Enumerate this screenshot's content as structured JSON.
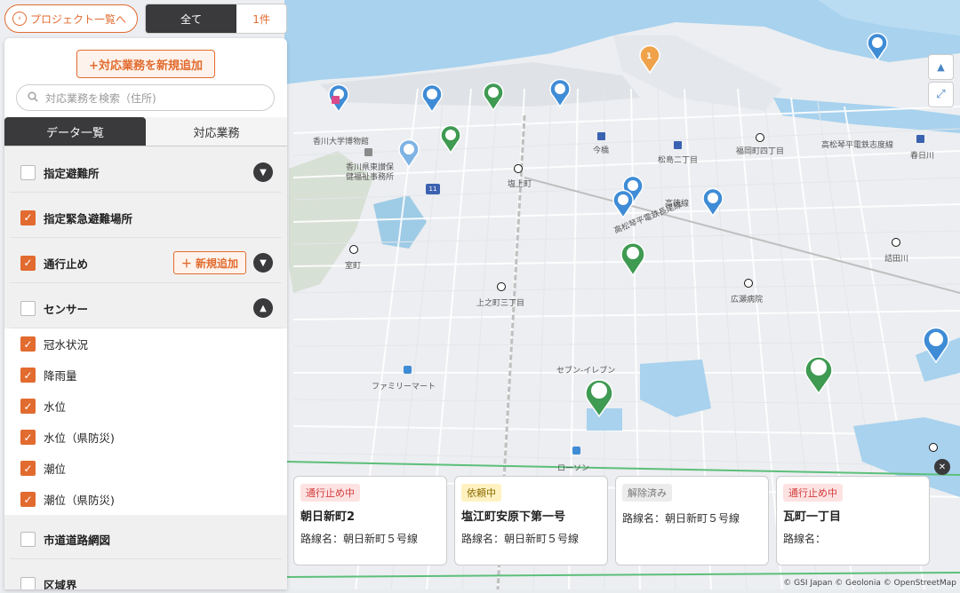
{
  "topbar": {
    "back_label": "プロジェクト一覧へ",
    "filter_all": "全て",
    "filter_count": "1件"
  },
  "panel": {
    "add_button": "+対応業務を新規追加",
    "search_placeholder": "対応業務を検索（住所)",
    "tabs": [
      "データ一覧",
      "対応業務"
    ],
    "rows": [
      {
        "label": "指定避難所",
        "checked": false,
        "chevron": "down"
      },
      {
        "label": "指定緊急避難場所",
        "checked": true
      },
      {
        "label": "通行止め",
        "checked": true,
        "chevron": "down",
        "add_label": "＋ 新規追加"
      },
      {
        "label": "センサー",
        "checked": false,
        "chevron": "up"
      },
      {
        "label": "冠水状況",
        "checked": true
      },
      {
        "label": "降雨量",
        "checked": true
      },
      {
        "label": "水位",
        "checked": true
      },
      {
        "label": "水位（県防災)",
        "checked": true
      },
      {
        "label": "潮位",
        "checked": true
      },
      {
        "label": "潮位（県防災)",
        "checked": true
      },
      {
        "label": "市道道路網図",
        "checked": false
      },
      {
        "label": "区域界",
        "checked": false
      }
    ]
  },
  "map": {
    "labels": [
      {
        "text": "香川大学博物館"
      },
      {
        "text": "香川県東讃保"
      },
      {
        "text": "健福祉事務所"
      },
      {
        "text": "塩上町"
      },
      {
        "text": "今橋"
      },
      {
        "text": "松島二丁目"
      },
      {
        "text": "福岡町四丁目"
      },
      {
        "text": "高松琴平電鉄志度線"
      },
      {
        "text": "春日川"
      },
      {
        "text": "高徳線"
      },
      {
        "text": "高松琴平電鉄長尾線"
      },
      {
        "text": "室町"
      },
      {
        "text": "上之町三丁目"
      },
      {
        "text": "詰田川"
      },
      {
        "text": "広瀬病院"
      },
      {
        "text": "セブン-イレブン"
      },
      {
        "text": "ファミリーマート"
      },
      {
        "text": "ローソン"
      }
    ],
    "cluster_count": "1",
    "road_number": "11",
    "attribution": "© GSI Japan  © Geolonia  © OpenStreetMap",
    "controls": [
      "compass-icon",
      "fullscreen-icon"
    ]
  },
  "incidents": [
    {
      "status": "通行止め中",
      "status_color": "red",
      "title": "朝日新町2",
      "route": "路線名：朝日新町５号線"
    },
    {
      "status": "依頼中",
      "status_color": "yellow",
      "title": "塩江町安原下第一号",
      "route": "路線名：朝日新町５号線"
    },
    {
      "status": "解除済み",
      "status_color": "gray",
      "title": "",
      "route": "路線名：朝日新町５号線"
    },
    {
      "status": "通行止め中",
      "status_color": "red",
      "title": "瓦町一丁目",
      "route": "路線名："
    }
  ],
  "colors": {
    "accent": "#e26b2f",
    "dark": "#3a3a3c",
    "water": "#a8d2ee",
    "marker_blue": "#3f8cd6",
    "marker_green": "#3f9a52"
  }
}
